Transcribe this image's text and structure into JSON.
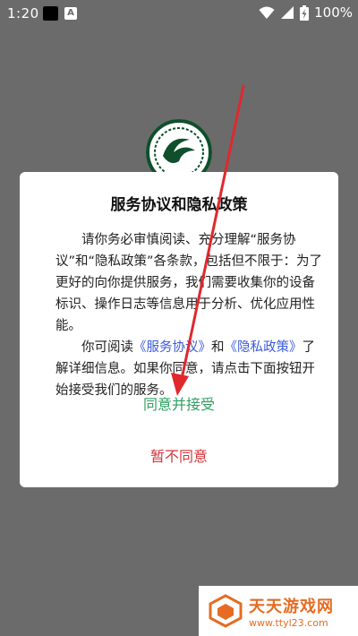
{
  "status_bar": {
    "time": "1:20",
    "battery": "100%",
    "icons": [
      "notification-black-square",
      "a-icon",
      "wifi-icon",
      "signal-icon",
      "battery-icon"
    ]
  },
  "dialog": {
    "title": "服务协议和隐私政策",
    "para1": "请你务必审慎阅读、充分理解“服务协议”和“隐私政策”各条款，包括但不限于：为了更好的向你提供服务，我们需要收集你的设备标识、操作日志等信息用于分析、优化应用性能。",
    "para2_prefix": "你可阅读",
    "link_service": "《服务协议》",
    "para2_and": "和",
    "link_privacy": "《隐私政策》",
    "para2_suffix": "了解详细信息。如果你同意，请点击下面按钮开始接受我们的服务。",
    "accept_label": "同意并接受",
    "decline_label": "暂不同意"
  },
  "watermark": {
    "name": "天天游戏网",
    "url": "www.ttyl23.com"
  },
  "colors": {
    "overlay": "#6b6b6b",
    "accept": "#2e9e60",
    "decline": "#d6343b",
    "link": "#3b5bdb",
    "annotation": "#e0282e",
    "watermark": "#e56c22"
  }
}
